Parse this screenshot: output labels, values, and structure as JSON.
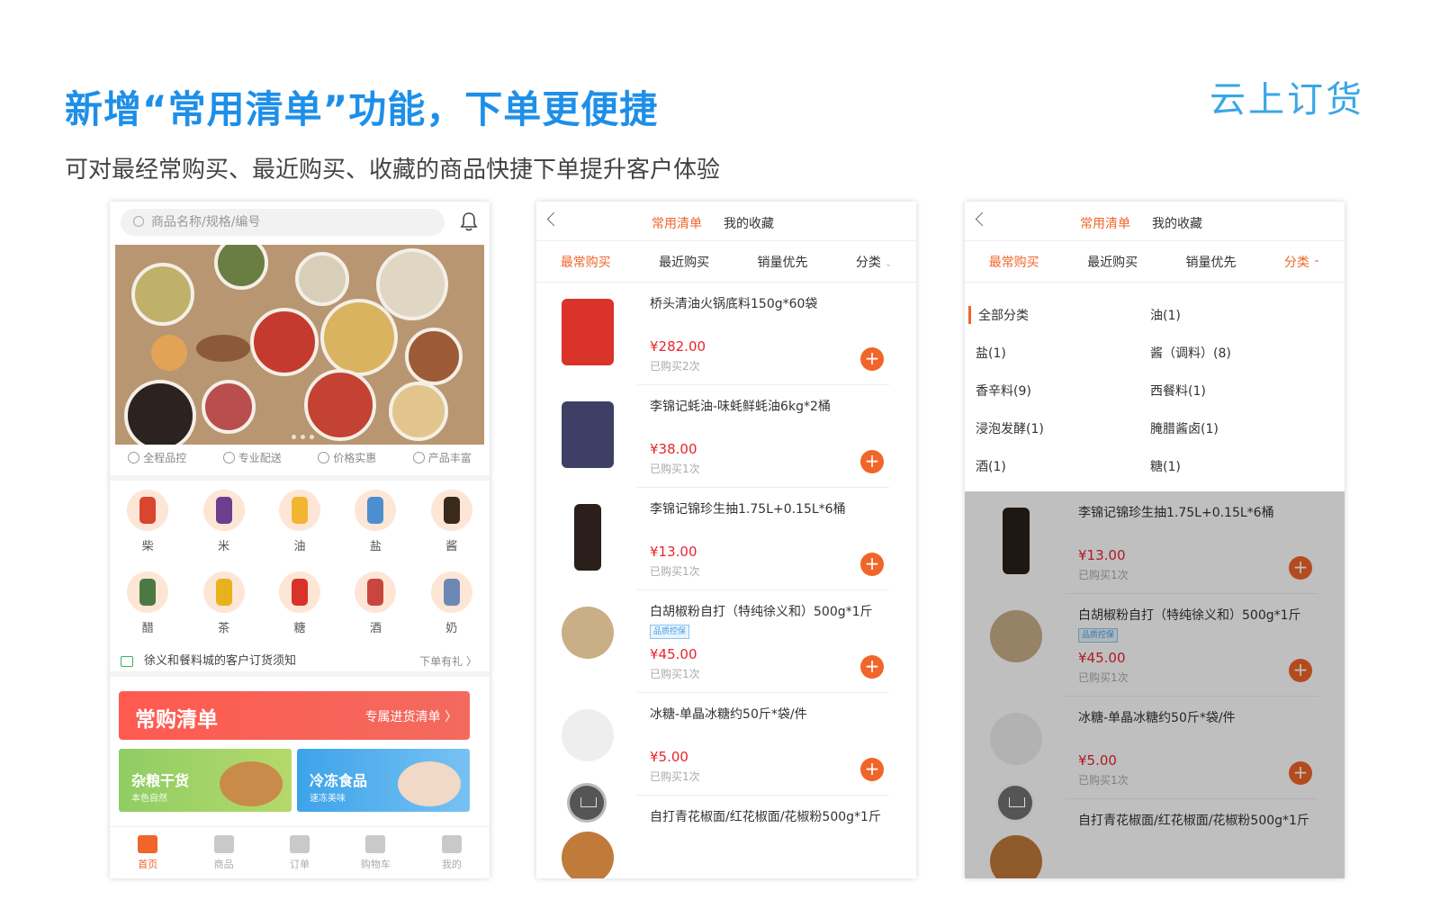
{
  "headline": "新增“常用清单”功能，下单更便捷",
  "subline": "可对最经常购买、最近购买、收藏的商品快捷下单提升客户体验",
  "brand": "云上订货",
  "phone1": {
    "search_placeholder": "商品名称/规格/编号",
    "features": [
      "全程品控",
      "专业配送",
      "价格实惠",
      "产品丰富"
    ],
    "categories": [
      "柴",
      "米",
      "油",
      "盐",
      "酱",
      "醋",
      "茶",
      "糖",
      "酒",
      "奶"
    ],
    "notice": "徐义和餐料城的客户订货须知",
    "notice_link": "下单有礼 〉",
    "promo_title": "常购清单",
    "promo_link": "专属进货清单 〉",
    "tiles": [
      {
        "title": "杂粮干货",
        "sub": "本色自然"
      },
      {
        "title": "冷冻食品",
        "sub": "速冻美味"
      }
    ],
    "tabs": [
      "首页",
      "商品",
      "订单",
      "购物车",
      "我的"
    ]
  },
  "list_nav": {
    "seg_active": "常用清单",
    "seg_other": "我的收藏"
  },
  "sort_tabs": [
    "最常购买",
    "最近购买",
    "销量优先",
    "分类"
  ],
  "products": [
    {
      "name": "桥头清油火锅底料150g*60袋",
      "price": "¥282.00",
      "count": "已购买2次",
      "tag": ""
    },
    {
      "name": "李锦记蚝油-味蚝鲜蚝油6kg*2桶",
      "price": "¥38.00",
      "count": "已购买1次",
      "tag": ""
    },
    {
      "name": "李锦记锦珍生抽1.75L+0.15L*6桶",
      "price": "¥13.00",
      "count": "已购买1次",
      "tag": ""
    },
    {
      "name": "白胡椒粉自打（特纯徐义和）500g*1斤",
      "price": "¥45.00",
      "count": "已购买1次",
      "tag": "品质控保"
    },
    {
      "name": "冰糖-单晶冰糖约50斤*袋/件",
      "price": "¥5.00",
      "count": "已购买1次",
      "tag": ""
    },
    {
      "name": "自打青花椒面/红花椒面/花椒粉500g*1斤",
      "price": "",
      "count": "",
      "tag": ""
    }
  ],
  "category_filter": [
    "全部分类",
    "油(1)",
    "盐(1)",
    "酱（调料）(8)",
    "香辛料(9)",
    "西餐料(1)",
    "浸泡发酵(1)",
    "腌腊酱卤(1)",
    "酒(1)",
    "糖(1)"
  ],
  "colors": {
    "accent": "#f0652a",
    "headline": "#1e8fe8",
    "price": "#e8252d"
  }
}
